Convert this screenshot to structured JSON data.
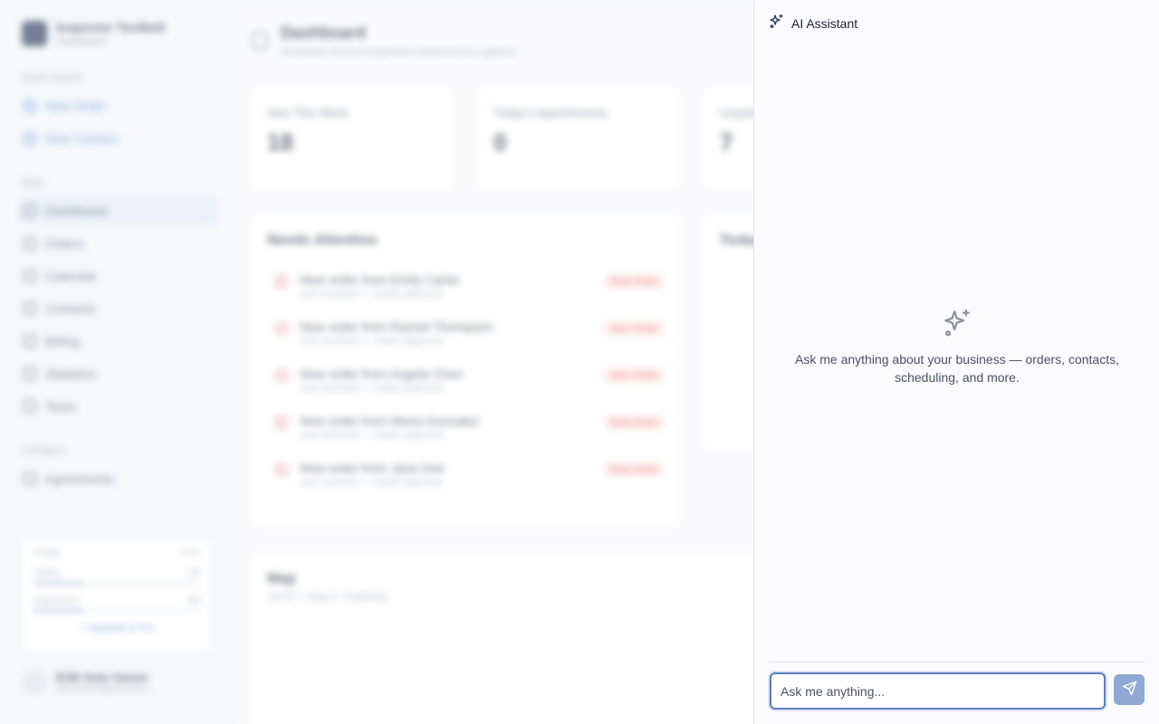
{
  "sidebar": {
    "brand_title": "Inspector Toolbelt",
    "brand_subtitle": "Dashboard",
    "quick_actions_label": "Quick Actions",
    "quick_actions": [
      "New Order",
      "New Contact"
    ],
    "main_label": "Main",
    "main_items": [
      "Dashboard",
      "Orders",
      "Calendar",
      "Contacts",
      "Billing",
      "Statistics",
      "Team"
    ],
    "configure_label": "Configure",
    "configure_items": [
      "Agreements"
    ],
    "usage": {
      "title": "Usage",
      "plan": "Free",
      "rows": [
        {
          "label": "Orders",
          "value": "0/5"
        },
        {
          "label": "Inspections",
          "value": "0/5"
        }
      ],
      "upgrade_label": "+ Upgrade to Pro"
    },
    "user": {
      "name": "ESB Solo Owner",
      "email": "solo.owner@esb-test.c..."
    }
  },
  "main": {
    "title": "Dashboard",
    "subtitle": "Overview of your inspection business at a glance.",
    "stats": [
      {
        "label": "New This Week",
        "value": "18"
      },
      {
        "label": "Today's Appointments",
        "value": "0"
      },
      {
        "label": "Unpaid",
        "value": "7"
      }
    ],
    "needs_attention": {
      "title": "Needs Attention",
      "items": [
        {
          "title": "New order from Emily Carter",
          "sub": "Just received — needs approval",
          "badge": "New Order"
        },
        {
          "title": "New order from Rachel Thompson",
          "sub": "Just received — needs approval",
          "badge": "New Order"
        },
        {
          "title": "New order from Angela Chen",
          "sub": "Just received — needs approval",
          "badge": "New Order"
        },
        {
          "title": "New order from Maria Gonzalez",
          "sub": "Just received — needs approval",
          "badge": "New Order"
        },
        {
          "title": "New order from Jane Doe",
          "sub": "Just received — needs approval",
          "badge": "New Order"
        }
      ]
    },
    "today_title": "Today",
    "map": {
      "title": "Map",
      "subtitle": "Jul 27 – Aug 2 • 0 pinned"
    }
  },
  "assistant": {
    "title": "AI Assistant",
    "empty_message": "Ask me anything about your business — orders, contacts, scheduling, and more.",
    "input_placeholder": "Ask me anything...",
    "input_value": ""
  },
  "icons": {
    "header": "sparkles-icon",
    "empty": "sparkles-icon",
    "send": "send-icon"
  },
  "colors": {
    "accent": "#5b7fbf",
    "send_button": "#8fa8d4",
    "danger": "#d94a4a"
  }
}
